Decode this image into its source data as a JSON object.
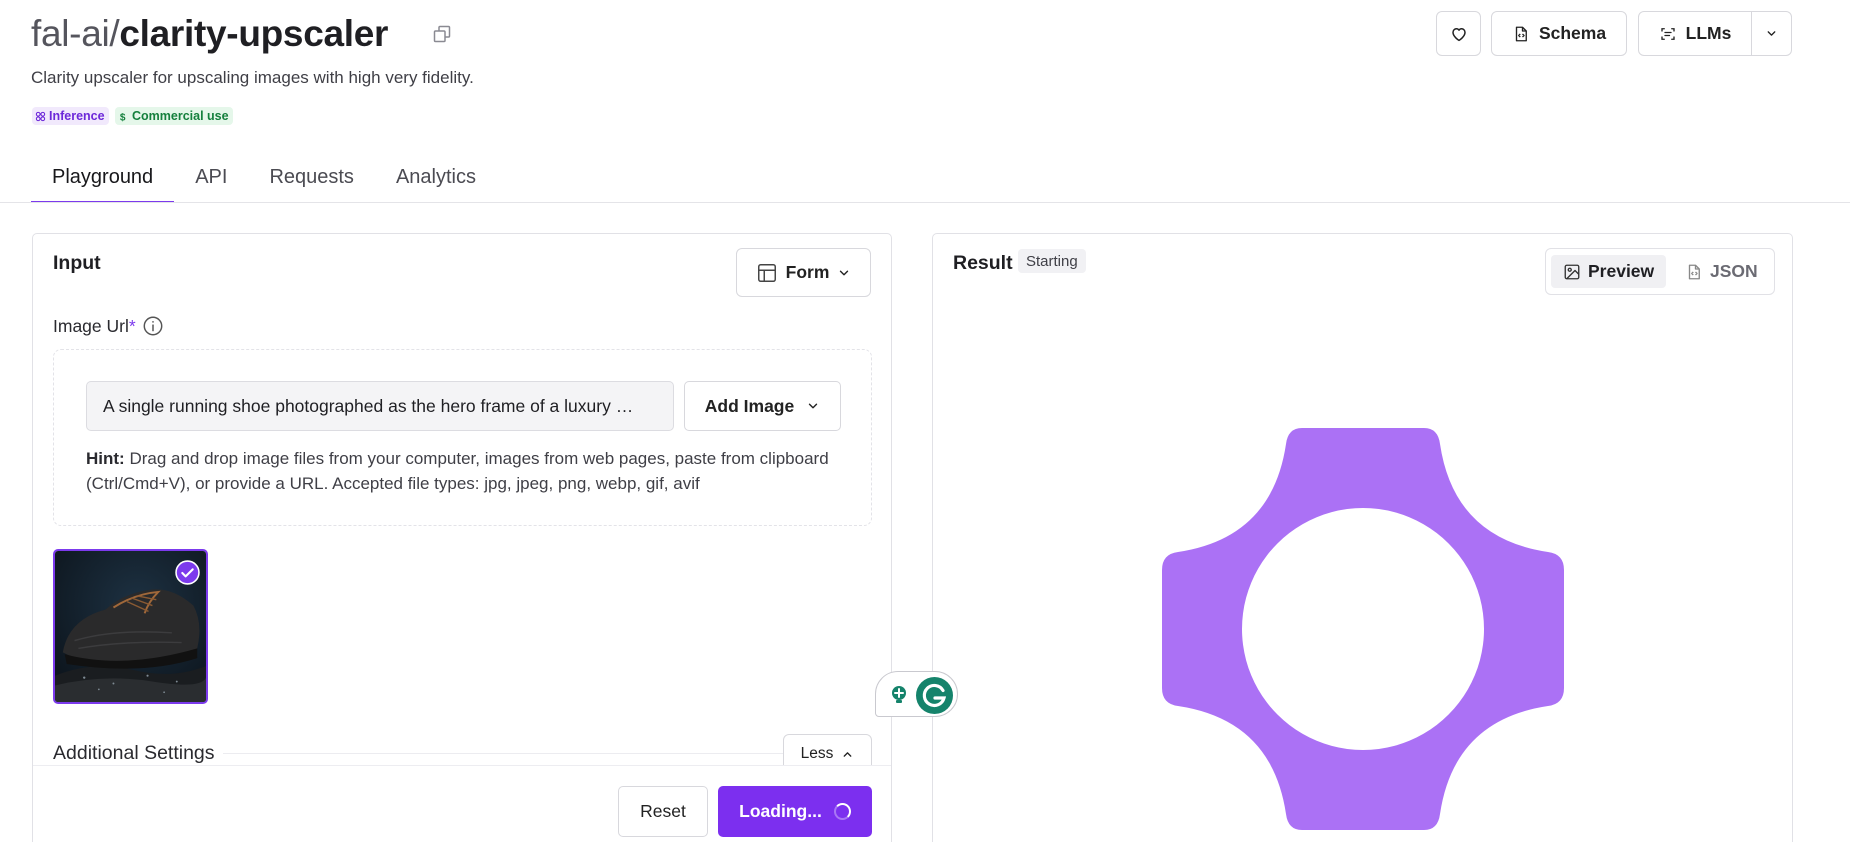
{
  "header": {
    "owner": "fal-ai/",
    "model": "clarity-upscaler",
    "description": "Clarity upscaler for upscaling images with high very fidelity.",
    "badges": {
      "inference": "Inference",
      "commercial": "Commercial use"
    },
    "buttons": {
      "schema": "Schema",
      "llms": "LLMs"
    }
  },
  "tabs": [
    {
      "label": "Playground",
      "active": true
    },
    {
      "label": "API",
      "active": false
    },
    {
      "label": "Requests",
      "active": false
    },
    {
      "label": "Analytics",
      "active": false
    }
  ],
  "input_panel": {
    "title": "Input",
    "mode_button": "Form",
    "image_url": {
      "label": "Image Url",
      "required_mark": "*",
      "value": "A single running shoe photographed as the hero frame of a luxury …",
      "add_button": "Add Image",
      "hint_label": "Hint:",
      "hint_text": " Drag and drop image files from your computer, images from web pages, paste from clipboard (Ctrl/Cmd+V), or provide a URL. Accepted file types: jpg, jpeg, png, webp, gif, avif"
    },
    "additional_settings": "Additional Settings",
    "less_button": "Less",
    "reset_button": "Reset",
    "run_button": "Loading..."
  },
  "result_panel": {
    "title": "Result",
    "status": "Starting",
    "views": {
      "preview": "Preview",
      "json": "JSON"
    }
  },
  "colors": {
    "accent": "#7c3aed",
    "loader": "#ab71f5",
    "grammarly": "#15836b"
  }
}
